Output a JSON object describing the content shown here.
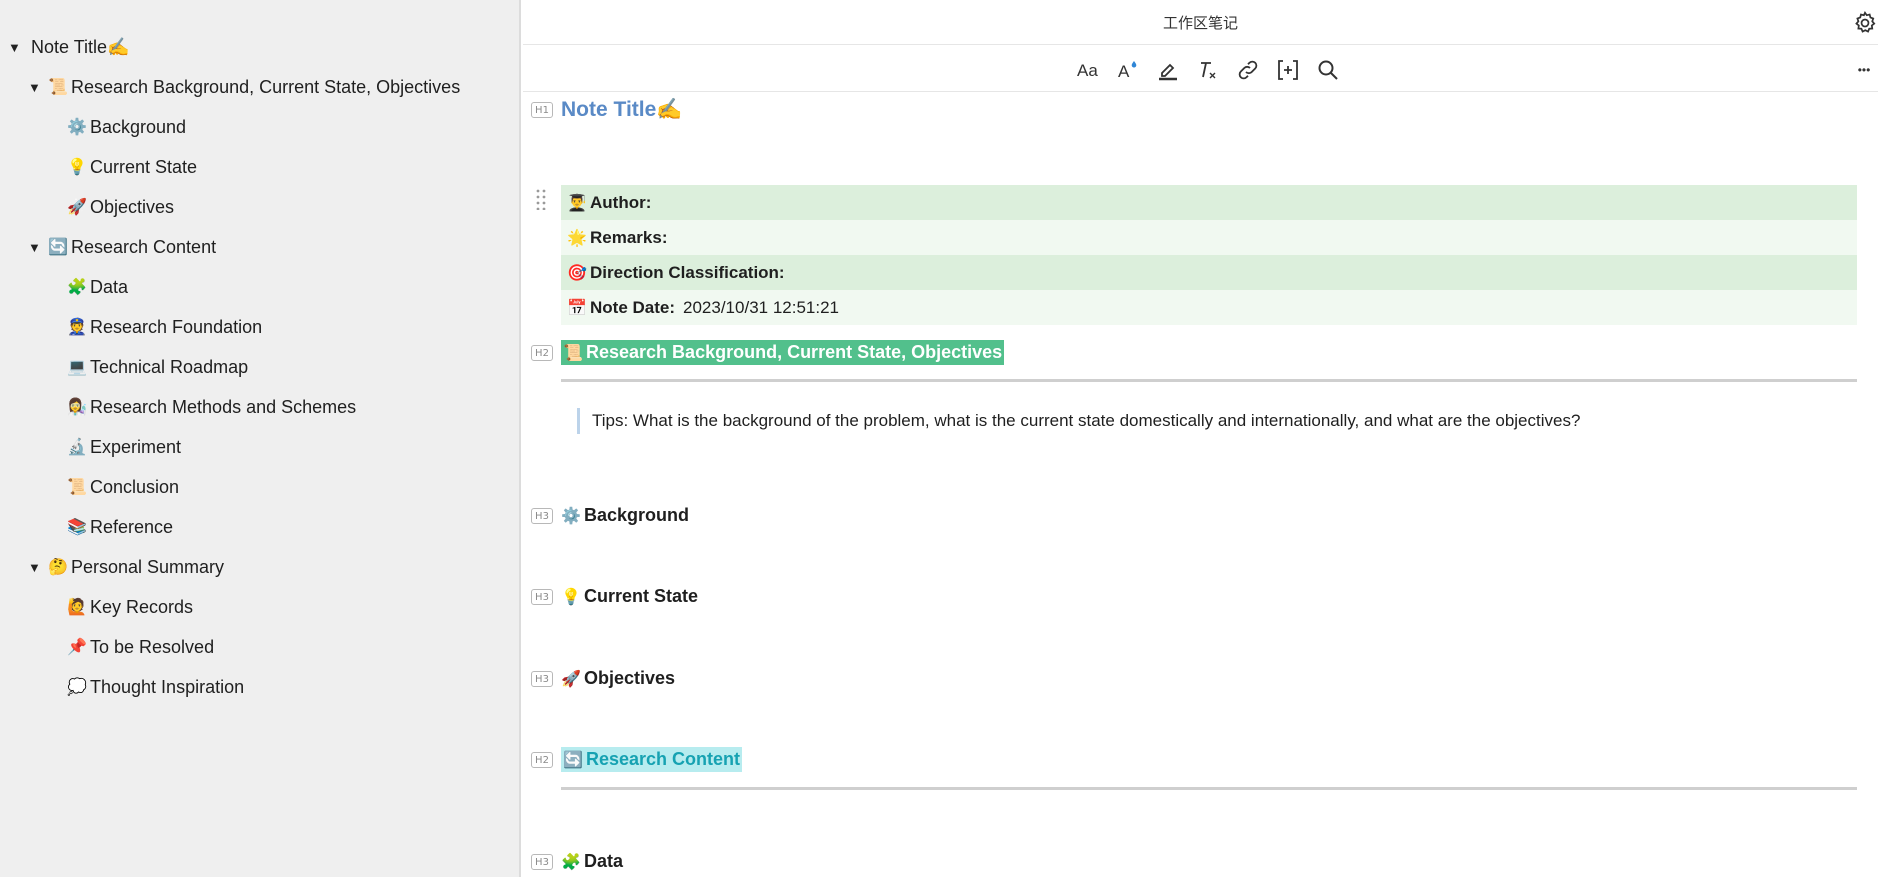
{
  "window": {
    "title": "工作区笔记"
  },
  "toolbar": {
    "buttons": [
      {
        "name": "font-size-icon"
      },
      {
        "name": "font-color-icon"
      },
      {
        "name": "highlight-icon"
      },
      {
        "name": "clear-format-icon"
      },
      {
        "name": "link-icon"
      },
      {
        "name": "insert-block-icon"
      },
      {
        "name": "search-icon"
      }
    ],
    "more_label": "•••"
  },
  "outline": {
    "items": [
      {
        "label": "Note Title✍️",
        "emoji": "",
        "level": 0,
        "caret": "▼"
      },
      {
        "label": "Research Background, Current State, Objectives",
        "emoji": "📜",
        "level": 1,
        "caret": "▼"
      },
      {
        "label": "Background",
        "emoji": "⚙️",
        "level": 2,
        "caret": ""
      },
      {
        "label": "Current State",
        "emoji": "💡",
        "level": 2,
        "caret": ""
      },
      {
        "label": "Objectives",
        "emoji": "🚀",
        "level": 2,
        "caret": ""
      },
      {
        "label": "Research Content",
        "emoji": "🔄",
        "level": 1,
        "caret": "▼"
      },
      {
        "label": "Data",
        "emoji": "🧩",
        "level": 2,
        "caret": ""
      },
      {
        "label": "Research Foundation",
        "emoji": "👮",
        "level": 2,
        "caret": ""
      },
      {
        "label": "Technical Roadmap",
        "emoji": "💻",
        "level": 2,
        "caret": ""
      },
      {
        "label": "Research Methods and Schemes",
        "emoji": "👩‍🔬",
        "level": 2,
        "caret": ""
      },
      {
        "label": "Experiment",
        "emoji": "🔬",
        "level": 2,
        "caret": ""
      },
      {
        "label": "Conclusion",
        "emoji": "📜",
        "level": 2,
        "caret": ""
      },
      {
        "label": "Reference",
        "emoji": "📚",
        "level": 2,
        "caret": ""
      },
      {
        "label": "Personal Summary",
        "emoji": "🤔",
        "level": 1,
        "caret": "▼"
      },
      {
        "label": "Key Records",
        "emoji": "🙋",
        "level": 2,
        "caret": ""
      },
      {
        "label": "To be Resolved",
        "emoji": "📌",
        "level": 2,
        "caret": ""
      },
      {
        "label": "Thought Inspiration",
        "emoji": "💭",
        "level": 2,
        "caret": ""
      }
    ]
  },
  "doc": {
    "h1": {
      "tag": "H1",
      "text": "Note Title✍️"
    },
    "meta": [
      {
        "emoji": "👨‍🎓",
        "key": "Author:",
        "value": ""
      },
      {
        "emoji": "🌟",
        "key": "Remarks:",
        "value": ""
      },
      {
        "emoji": "🎯",
        "key": "Direction Classification:",
        "value": ""
      },
      {
        "emoji": "📅",
        "key": "Note Date:",
        "value": "2023/10/31 12:51:21"
      }
    ],
    "h2_bg": {
      "tag": "H2",
      "emoji": "📜",
      "text": "Research Background, Current State, Objectives"
    },
    "tips": "Tips: What is the background of the problem, what is the current state domestically and internationally, and what are the objectives?",
    "h3_background": {
      "tag": "H3",
      "emoji": "⚙️",
      "text": "Background"
    },
    "h3_current": {
      "tag": "H3",
      "emoji": "💡",
      "text": "Current State"
    },
    "h3_objectives": {
      "tag": "H3",
      "emoji": "🚀",
      "text": "Objectives"
    },
    "h2_content": {
      "tag": "H2",
      "emoji": "🔄",
      "text": "Research Content"
    },
    "h3_data": {
      "tag": "H3",
      "emoji": "🧩",
      "text": "Data"
    }
  },
  "colors": {
    "h1": "#5a8ac6",
    "h2_green_bg": "#52c08c",
    "h2_cyan_bg": "#b7ecef",
    "h2_cyan_text": "#16a2b2",
    "meta_row_odd": "#dcefdc",
    "meta_row_even": "#f1f9f1",
    "sidebar_bg": "#efefef"
  }
}
